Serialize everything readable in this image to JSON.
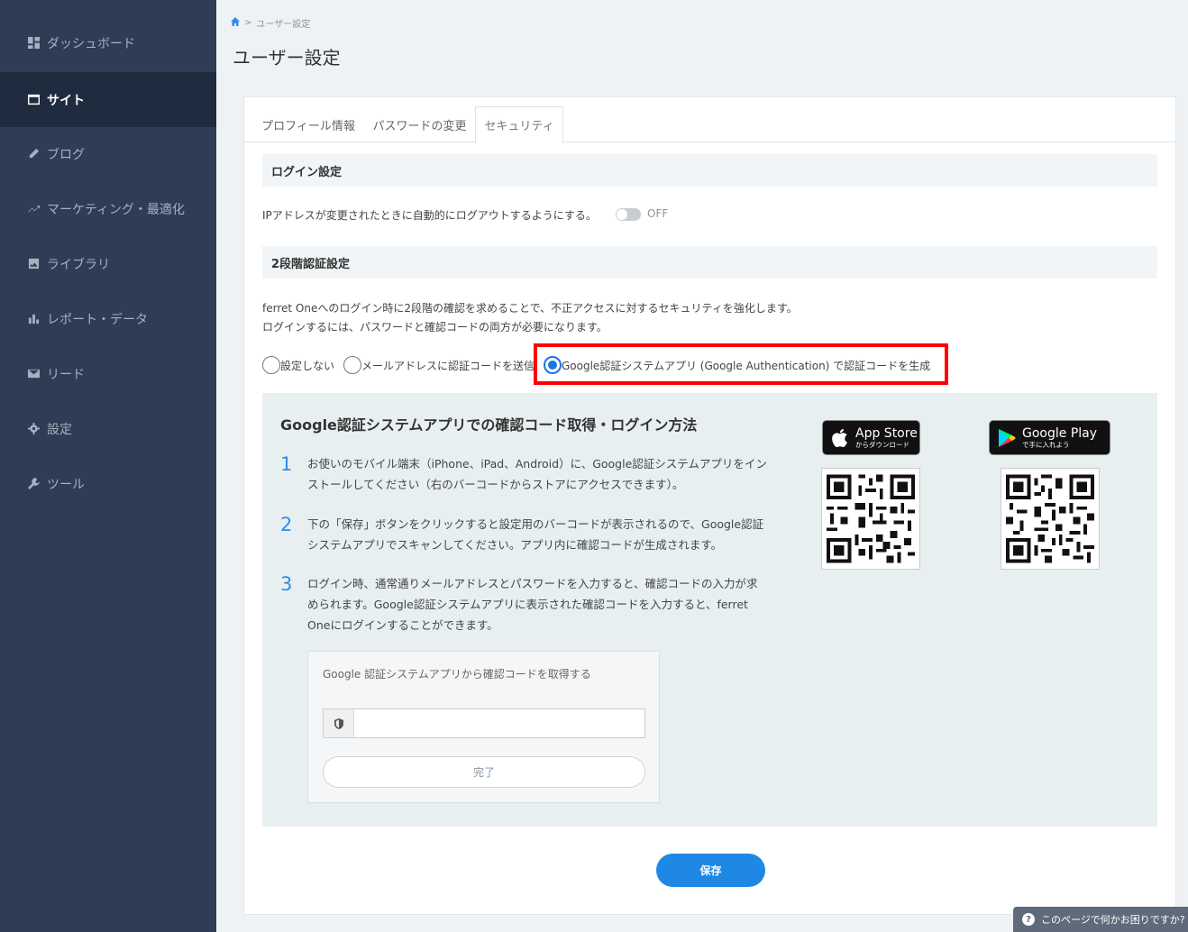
{
  "sidebar": {
    "items": [
      {
        "label": "ダッシュボード",
        "icon": "dashboard-icon"
      },
      {
        "label": "サイト",
        "icon": "site-icon",
        "active": true
      },
      {
        "label": "ブログ",
        "icon": "pencil-icon"
      },
      {
        "label": "マーケティング・最適化",
        "icon": "trend-icon"
      },
      {
        "label": "ライブラリ",
        "icon": "image-icon"
      },
      {
        "label": "レポート・データ",
        "icon": "bar-chart-icon"
      },
      {
        "label": "リード",
        "icon": "mail-icon"
      },
      {
        "label": "設定",
        "icon": "gear-icon"
      },
      {
        "label": "ツール",
        "icon": "wrench-icon"
      }
    ]
  },
  "breadcrumb": {
    "separator": ">",
    "current": "ユーザー設定"
  },
  "page": {
    "title": "ユーザー設定"
  },
  "tabs": [
    {
      "label": "プロフィール情報"
    },
    {
      "label": "パスワードの変更"
    },
    {
      "label": "セキュリティ",
      "active": true
    }
  ],
  "login_settings": {
    "heading": "ログイン設定",
    "auto_logout_text": "IPアドレスが変更されたときに自動的にログアウトするようにする。",
    "toggle_state": "OFF"
  },
  "two_factor": {
    "heading": "2段階認証設定",
    "description_line1": "ferret Oneへのログイン時に2段階の確認を求めることで、不正アクセスに対するセキュリティを強化します。",
    "description_line2": "ログインするには、パスワードと確認コードの両方が必要になります。",
    "options": [
      {
        "label": "設定しない",
        "checked": false
      },
      {
        "label": "メールアドレスに認証コードを送信",
        "checked": false
      },
      {
        "label": "Google認証システムアプリ (Google Authentication) で認証コードを生成",
        "checked": true
      }
    ]
  },
  "guide": {
    "title": "Google認証システムアプリでの確認コード取得・ログイン方法",
    "steps": [
      {
        "num": "1",
        "line1": "お使いのモバイル端末（iPhone、iPad、Android）に、Google認証システムアプリをイン",
        "line2": "ストールしてください（右のバーコードからストアにアクセスできます）。"
      },
      {
        "num": "2",
        "line1": "下の「保存」ボタンをクリックすると設定用のバーコードが表示されるので、Google認証",
        "line2": "システムアプリでスキャンしてください。アプリ内に確認コードが生成されます。"
      },
      {
        "num": "3",
        "line1": "ログイン時、通常通りメールアドレスとパスワードを入力すると、確認コードの入力が求",
        "line2": "められます。Google認証システムアプリに表示された確認コードを入力すると、ferret",
        "line3": "Oneにログインすることができます。"
      }
    ],
    "app_store": {
      "main": "App Store",
      "sub": "からダウンロード"
    },
    "google_play": {
      "main": "Google Play",
      "sub": "で手に入れよう"
    },
    "code_box": {
      "title": "Google 認証システムアプリから確認コードを取得する",
      "input_value": "",
      "input_placeholder": "",
      "done_label": "完了"
    }
  },
  "save_label": "保存",
  "help_label": "このページで何かお困りですか?",
  "colors": {
    "sidebar": "#2e3d55",
    "sidebar_active": "#1f2b3e",
    "accent": "#1f88e5",
    "highlight": "#ff0000"
  }
}
